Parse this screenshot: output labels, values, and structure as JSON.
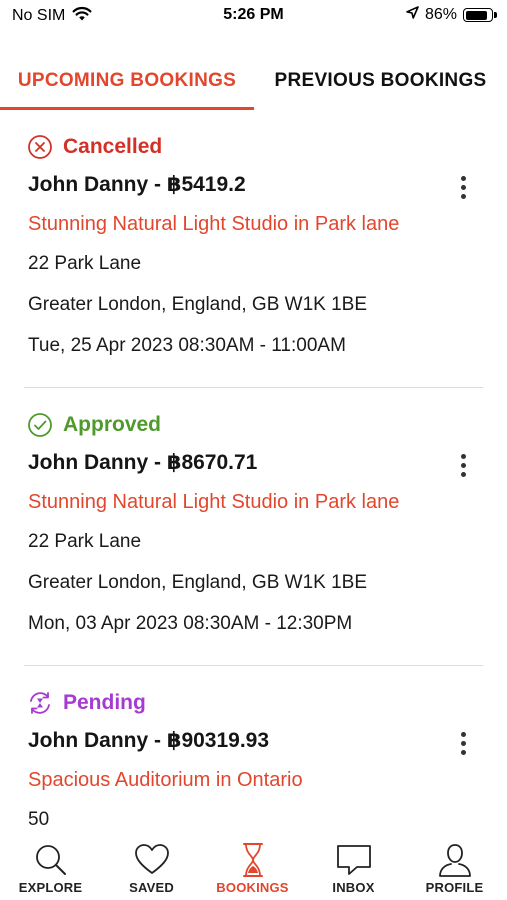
{
  "status_bar": {
    "carrier": "No SIM",
    "time": "5:26 PM",
    "battery": "86%",
    "battery_level": 0.86
  },
  "tabs": [
    {
      "label": "UPCOMING BOOKINGS",
      "active": true
    },
    {
      "label": "PREVIOUS BOOKINGS",
      "active": false
    }
  ],
  "bookings": [
    {
      "status": "Cancelled",
      "status_icon": "x-circle-icon",
      "title": "John Danny - ฿5419.2",
      "listing": "Stunning Natural Light Studio in Park lane",
      "address1": "22 Park Lane",
      "address2": "Greater London, England, GB W1K 1BE",
      "datetime": "Tue, 25 Apr 2023 08:30AM - 11:00AM"
    },
    {
      "status": "Approved",
      "status_icon": "check-circle-icon",
      "title": "John Danny - ฿8670.71",
      "listing": "Stunning Natural Light Studio in Park lane",
      "address1": "22 Park Lane",
      "address2": "Greater London, England, GB W1K 1BE",
      "datetime": "Mon, 03 Apr 2023 08:30AM - 12:30PM"
    },
    {
      "status": "Pending",
      "status_icon": "hourglass-circle-icon",
      "title": "John Danny - ฿90319.93",
      "listing": "Spacious Auditorium in Ontario",
      "address1": "50",
      "address2": "",
      "datetime": ""
    }
  ],
  "nav": [
    {
      "label": "EXPLORE",
      "icon": "search-icon",
      "active": false
    },
    {
      "label": "SAVED",
      "icon": "heart-icon",
      "active": false
    },
    {
      "label": "BOOKINGS",
      "icon": "hourglass-icon",
      "active": true
    },
    {
      "label": "INBOX",
      "icon": "chat-bubble-icon",
      "active": false
    },
    {
      "label": "PROFILE",
      "icon": "person-icon",
      "active": false
    }
  ],
  "colors": {
    "accent": "#e2462d",
    "cancelled": "#d23127",
    "approved": "#4f9a2a",
    "pending": "#a63bd2"
  }
}
